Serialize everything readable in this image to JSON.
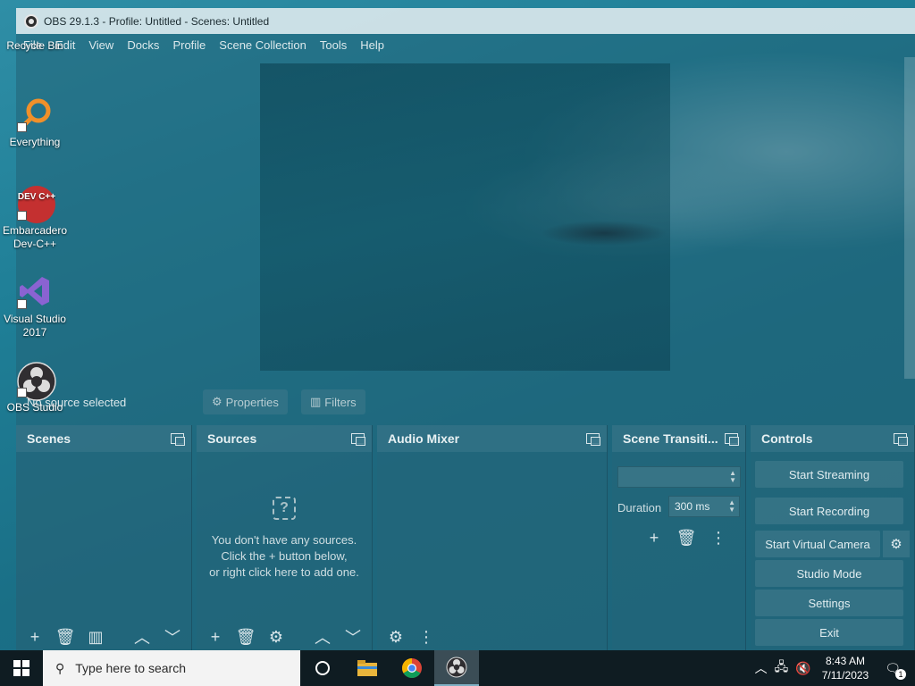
{
  "window": {
    "title": "OBS 29.1.3 - Profile: Untitled - Scenes: Untitled"
  },
  "menu": [
    "File",
    "Edit",
    "View",
    "Docks",
    "Profile",
    "Scene Collection",
    "Tools",
    "Help"
  ],
  "source_toolbar": {
    "status": "No source selected",
    "properties_label": "Properties",
    "filters_label": "Filters"
  },
  "docks": {
    "scenes": {
      "title": "Scenes"
    },
    "sources": {
      "title": "Sources",
      "empty_line1": "You don't have any sources.",
      "empty_line2": "Click the + button below,",
      "empty_line3": "or right click here to add one."
    },
    "audio": {
      "title": "Audio Mixer"
    },
    "transitions": {
      "title": "Scene Transiti...",
      "duration_label": "Duration",
      "duration_value": "300 ms"
    },
    "controls": {
      "title": "Controls",
      "buttons": [
        "Start Streaming",
        "Start Recording",
        "Start Virtual Camera",
        "Studio Mode",
        "Settings",
        "Exit"
      ]
    }
  },
  "desktop_icons": [
    {
      "label": "Recycle Bin"
    },
    {
      "label": "Everything"
    },
    {
      "label": "Embarcadero Dev-C++"
    },
    {
      "label": "Visual Studio 2017"
    },
    {
      "label": "OBS Studio"
    }
  ],
  "taskbar": {
    "search_placeholder": "Type here to search",
    "time": "8:43 AM",
    "date": "7/11/2023",
    "notification_count": "1"
  },
  "icons": {
    "dev_cpp_text": "DEV C++"
  }
}
